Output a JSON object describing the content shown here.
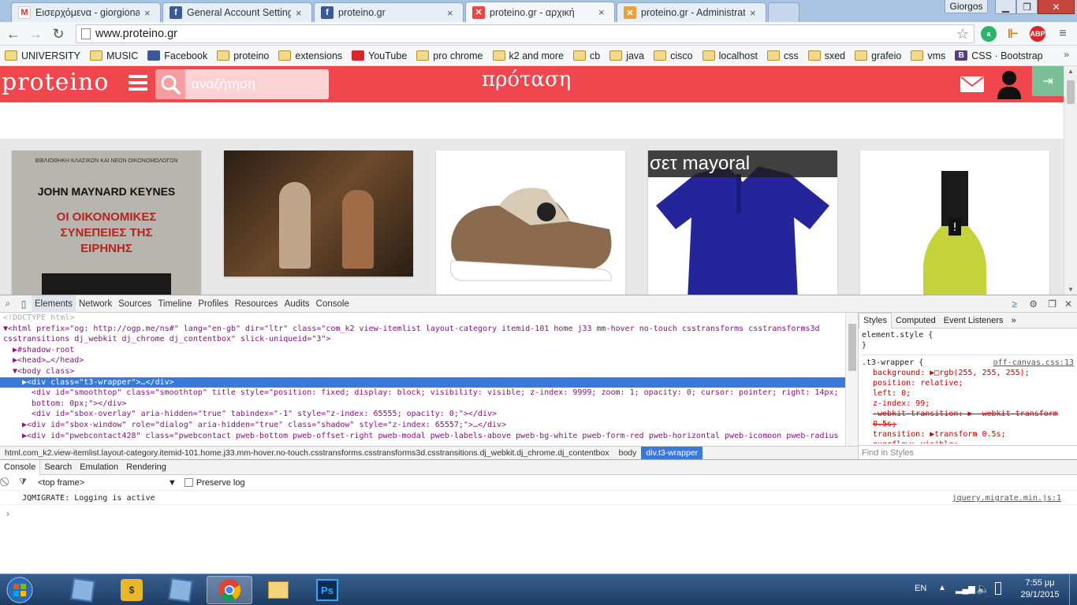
{
  "browser": {
    "tabs": [
      {
        "title": "Εισερχόμενα - giorgionasi",
        "icon": "gmail-icon"
      },
      {
        "title": "General Account Settings",
        "icon": "facebook-icon"
      },
      {
        "title": "proteino.gr",
        "icon": "facebook-icon"
      },
      {
        "title": "proteino.gr - αρχική",
        "icon": "joomla-icon",
        "active": true
      },
      {
        "title": "proteino.gr - Administrati",
        "icon": "joomla-icon"
      }
    ],
    "user": "Giorgos",
    "url": "www.proteino.gr",
    "bookmarks": [
      {
        "label": "UNIVERSITY",
        "icon": "folder"
      },
      {
        "label": "MUSIC",
        "icon": "folder"
      },
      {
        "label": "Facebook",
        "icon": "facebook"
      },
      {
        "label": "proteino",
        "icon": "folder"
      },
      {
        "label": "extensions",
        "icon": "folder"
      },
      {
        "label": "YouTube",
        "icon": "youtube"
      },
      {
        "label": "pro chrome",
        "icon": "folder"
      },
      {
        "label": "k2 and more",
        "icon": "folder"
      },
      {
        "label": "cb",
        "icon": "folder"
      },
      {
        "label": "java",
        "icon": "folder"
      },
      {
        "label": "cisco",
        "icon": "folder"
      },
      {
        "label": "localhost",
        "icon": "folder"
      },
      {
        "label": "css",
        "icon": "folder"
      },
      {
        "label": "sxed",
        "icon": "folder"
      },
      {
        "label": "grafeio",
        "icon": "folder"
      },
      {
        "label": "vms",
        "icon": "folder"
      },
      {
        "label": "CSS · Bootstrap",
        "icon": "bootstrap"
      }
    ],
    "bookmarks_more": "»",
    "ext_abp": "ABP"
  },
  "site": {
    "logo": "proteino",
    "search_placeholder": "αναζήτηση",
    "center_logo": "πρόταση",
    "logout_label": "⇥",
    "brand_color": "#f0474f",
    "cards": [
      {
        "title": "",
        "image": "book-keynes"
      },
      {
        "title": "",
        "image": "theatre-scene"
      },
      {
        "title": "",
        "image": "sneaker"
      },
      {
        "title": "σετ mayoral",
        "image": "polo-shirt"
      },
      {
        "title": "",
        "image": "wine-bottle"
      }
    ],
    "book_lines": [
      "ΒΙΒΛΙΟΘΗΚΗ ΚΛΑΣΙΚΩΝ ΚΑΙ ΝΕΩΝ ΟΙΚΟΝΟΜΟΛΟΓΩΝ",
      "JOHN MAYNARD KEYNES",
      "ΟΙ ΟΙΚΟΝΟΜΙΚΕΣ",
      "ΣΥΝΕΠΕΙΕΣ ΤΗΣ",
      "ΕΙΡΗΝΗΣ"
    ]
  },
  "devtools": {
    "tabs": [
      "Elements",
      "Network",
      "Sources",
      "Timeline",
      "Profiles",
      "Resources",
      "Audits",
      "Console"
    ],
    "dom_lines": [
      {
        "indent": 0,
        "text": "<!DOCTYPE html>",
        "type": "comment"
      },
      {
        "indent": 0,
        "text": "▼<html prefix=\"og: http://ogp.me/ns#\" lang=\"en-gb\" dir=\"ltr\" class=\"com_k2 view-itemlist layout-category itemid-101 home j33 mm-hover no-touch csstransforms csstransforms3d",
        "type": "tag"
      },
      {
        "indent": 0,
        "text": "csstransitions dj_webkit dj_chrome dj_contentbox\" slick-uniqueid=\"3\">",
        "type": "tag"
      },
      {
        "indent": 1,
        "text": "▶#shadow-root",
        "type": "plain"
      },
      {
        "indent": 1,
        "text": "▶<head>…</head>",
        "type": "tag"
      },
      {
        "indent": 1,
        "text": "▼<body class>",
        "type": "tag"
      },
      {
        "indent": 2,
        "text": "▶<div class=\"t3-wrapper\">…</div>",
        "type": "tag",
        "selected": true
      },
      {
        "indent": 3,
        "text": "<div id=\"smoothtop\" class=\"smoothtop\" title style=\"position: fixed; display: block; visibility: visible; z-index: 9999; zoom: 1; opacity: 0; cursor: pointer; right: 14px;",
        "type": "tag"
      },
      {
        "indent": 3,
        "text": "bottom: 0px;\"></div>",
        "type": "tag"
      },
      {
        "indent": 3,
        "text": "<div id=\"sbox-overlay\" aria-hidden=\"true\" tabindex=\"-1\" style=\"z-index: 65555; opacity: 0;\"></div>",
        "type": "tag"
      },
      {
        "indent": 2,
        "text": "▶<div id=\"sbox-window\" role=\"dialog\" aria-hidden=\"true\" class=\"shadow\" style=\"z-index: 65557;\">…</div>",
        "type": "tag"
      },
      {
        "indent": 2,
        "text": "▶<div id=\"pwebcontact428\" class=\"pwebcontact pweb-bottom pweb-offset-right pweb-modal pweb-labels-above pweb-bg-white pweb-form-red pweb-horizontal pweb-icomoon pweb-radius",
        "type": "tag"
      }
    ],
    "breadcrumb": [
      "html.com_k2.view-itemlist.layout-category.itemid-101.home.j33.mm-hover.no-touch.csstransforms.csstransforms3d.csstransitions.dj_webkit.dj_chrome.dj_contentbox",
      "body",
      "div.t3-wrapper"
    ],
    "styles_tabs": [
      "Styles",
      "Computed",
      "Event Listeners",
      "»"
    ],
    "styles_lines": [
      {
        "text": "element.style {",
        "cls": ""
      },
      {
        "text": "}",
        "cls": ""
      },
      {
        "text": ".t3-wrapper {",
        "cls": "",
        "source": "off-canvas.css:13"
      },
      {
        "text": "background: ▶□rgb(255, 255, 255);",
        "cls": "prop"
      },
      {
        "text": "position: relative;",
        "cls": "prop"
      },
      {
        "text": "left: 0;",
        "cls": "prop"
      },
      {
        "text": "z-index: 99;",
        "cls": "prop"
      },
      {
        "text": "-webkit-transition: ▶ -webkit-transform",
        "cls": "prop strike"
      },
      {
        "text": "  0.5s;",
        "cls": "prop strike"
      },
      {
        "text": "transition: ▶transform 0.5s;",
        "cls": "prop"
      },
      {
        "text": "overflow: visible;",
        "cls": "prop"
      }
    ],
    "find_styles": "Find in Styles",
    "drawer_tabs": [
      "Console",
      "Search",
      "Emulation",
      "Rendering"
    ],
    "frame": "<top frame>",
    "preserve_log": "Preserve log",
    "console_messages": [
      {
        "text": "JQMIGRATE: Logging is active",
        "source": "jquery.migrate.min.js:1"
      }
    ],
    "prompt": "›"
  },
  "taskbar": {
    "language": "EN",
    "time": "7:55 μμ",
    "date": "29/1/2015"
  }
}
